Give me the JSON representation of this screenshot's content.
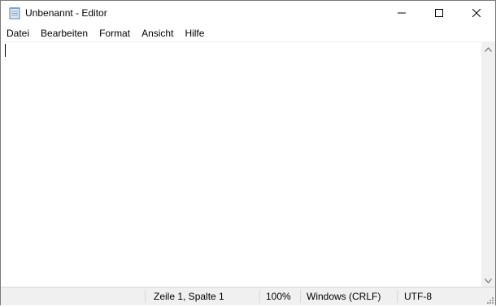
{
  "window": {
    "title": "Unbenannt - Editor"
  },
  "icons": {
    "app": "notepad-icon",
    "minimize": "minimize-icon",
    "maximize": "maximize-icon",
    "close": "close-icon",
    "scroll_up": "chevron-up-icon",
    "scroll_down": "chevron-down-icon",
    "resize_grip": "resize-grip-icon"
  },
  "menu": {
    "items": [
      "Datei",
      "Bearbeiten",
      "Format",
      "Ansicht",
      "Hilfe"
    ]
  },
  "editor": {
    "content": ""
  },
  "status": {
    "position": "Zeile 1, Spalte 1",
    "zoom": "100%",
    "line_ending": "Windows (CRLF)",
    "encoding": "UTF-8"
  },
  "colors": {
    "statusbar_bg": "#f0f0f0",
    "border": "#7a7a7a"
  }
}
